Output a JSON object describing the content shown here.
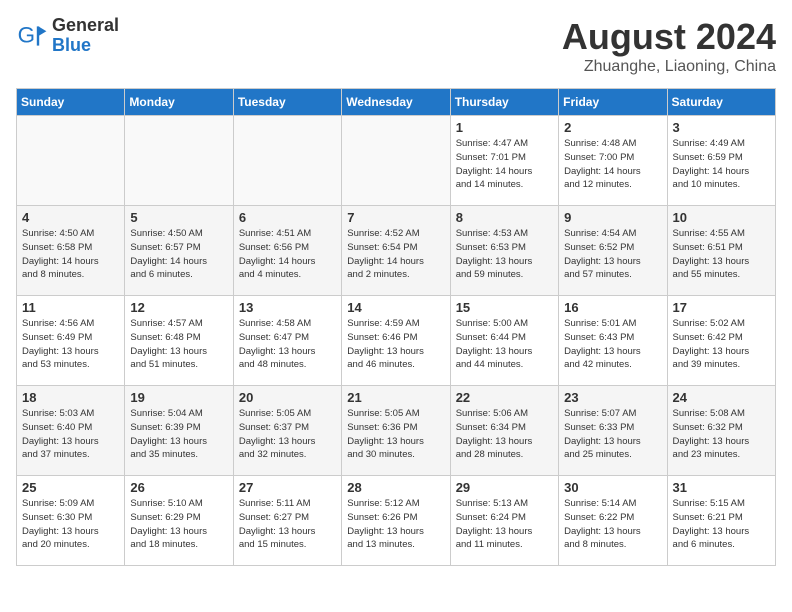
{
  "header": {
    "logo_general": "General",
    "logo_blue": "Blue",
    "month_title": "August 2024",
    "subtitle": "Zhuanghe, Liaoning, China"
  },
  "days_of_week": [
    "Sunday",
    "Monday",
    "Tuesday",
    "Wednesday",
    "Thursday",
    "Friday",
    "Saturday"
  ],
  "weeks": [
    [
      {
        "day": "",
        "detail": ""
      },
      {
        "day": "",
        "detail": ""
      },
      {
        "day": "",
        "detail": ""
      },
      {
        "day": "",
        "detail": ""
      },
      {
        "day": "1",
        "detail": "Sunrise: 4:47 AM\nSunset: 7:01 PM\nDaylight: 14 hours\nand 14 minutes."
      },
      {
        "day": "2",
        "detail": "Sunrise: 4:48 AM\nSunset: 7:00 PM\nDaylight: 14 hours\nand 12 minutes."
      },
      {
        "day": "3",
        "detail": "Sunrise: 4:49 AM\nSunset: 6:59 PM\nDaylight: 14 hours\nand 10 minutes."
      }
    ],
    [
      {
        "day": "4",
        "detail": "Sunrise: 4:50 AM\nSunset: 6:58 PM\nDaylight: 14 hours\nand 8 minutes."
      },
      {
        "day": "5",
        "detail": "Sunrise: 4:50 AM\nSunset: 6:57 PM\nDaylight: 14 hours\nand 6 minutes."
      },
      {
        "day": "6",
        "detail": "Sunrise: 4:51 AM\nSunset: 6:56 PM\nDaylight: 14 hours\nand 4 minutes."
      },
      {
        "day": "7",
        "detail": "Sunrise: 4:52 AM\nSunset: 6:54 PM\nDaylight: 14 hours\nand 2 minutes."
      },
      {
        "day": "8",
        "detail": "Sunrise: 4:53 AM\nSunset: 6:53 PM\nDaylight: 13 hours\nand 59 minutes."
      },
      {
        "day": "9",
        "detail": "Sunrise: 4:54 AM\nSunset: 6:52 PM\nDaylight: 13 hours\nand 57 minutes."
      },
      {
        "day": "10",
        "detail": "Sunrise: 4:55 AM\nSunset: 6:51 PM\nDaylight: 13 hours\nand 55 minutes."
      }
    ],
    [
      {
        "day": "11",
        "detail": "Sunrise: 4:56 AM\nSunset: 6:49 PM\nDaylight: 13 hours\nand 53 minutes."
      },
      {
        "day": "12",
        "detail": "Sunrise: 4:57 AM\nSunset: 6:48 PM\nDaylight: 13 hours\nand 51 minutes."
      },
      {
        "day": "13",
        "detail": "Sunrise: 4:58 AM\nSunset: 6:47 PM\nDaylight: 13 hours\nand 48 minutes."
      },
      {
        "day": "14",
        "detail": "Sunrise: 4:59 AM\nSunset: 6:46 PM\nDaylight: 13 hours\nand 46 minutes."
      },
      {
        "day": "15",
        "detail": "Sunrise: 5:00 AM\nSunset: 6:44 PM\nDaylight: 13 hours\nand 44 minutes."
      },
      {
        "day": "16",
        "detail": "Sunrise: 5:01 AM\nSunset: 6:43 PM\nDaylight: 13 hours\nand 42 minutes."
      },
      {
        "day": "17",
        "detail": "Sunrise: 5:02 AM\nSunset: 6:42 PM\nDaylight: 13 hours\nand 39 minutes."
      }
    ],
    [
      {
        "day": "18",
        "detail": "Sunrise: 5:03 AM\nSunset: 6:40 PM\nDaylight: 13 hours\nand 37 minutes."
      },
      {
        "day": "19",
        "detail": "Sunrise: 5:04 AM\nSunset: 6:39 PM\nDaylight: 13 hours\nand 35 minutes."
      },
      {
        "day": "20",
        "detail": "Sunrise: 5:05 AM\nSunset: 6:37 PM\nDaylight: 13 hours\nand 32 minutes."
      },
      {
        "day": "21",
        "detail": "Sunrise: 5:05 AM\nSunset: 6:36 PM\nDaylight: 13 hours\nand 30 minutes."
      },
      {
        "day": "22",
        "detail": "Sunrise: 5:06 AM\nSunset: 6:34 PM\nDaylight: 13 hours\nand 28 minutes."
      },
      {
        "day": "23",
        "detail": "Sunrise: 5:07 AM\nSunset: 6:33 PM\nDaylight: 13 hours\nand 25 minutes."
      },
      {
        "day": "24",
        "detail": "Sunrise: 5:08 AM\nSunset: 6:32 PM\nDaylight: 13 hours\nand 23 minutes."
      }
    ],
    [
      {
        "day": "25",
        "detail": "Sunrise: 5:09 AM\nSunset: 6:30 PM\nDaylight: 13 hours\nand 20 minutes."
      },
      {
        "day": "26",
        "detail": "Sunrise: 5:10 AM\nSunset: 6:29 PM\nDaylight: 13 hours\nand 18 minutes."
      },
      {
        "day": "27",
        "detail": "Sunrise: 5:11 AM\nSunset: 6:27 PM\nDaylight: 13 hours\nand 15 minutes."
      },
      {
        "day": "28",
        "detail": "Sunrise: 5:12 AM\nSunset: 6:26 PM\nDaylight: 13 hours\nand 13 minutes."
      },
      {
        "day": "29",
        "detail": "Sunrise: 5:13 AM\nSunset: 6:24 PM\nDaylight: 13 hours\nand 11 minutes."
      },
      {
        "day": "30",
        "detail": "Sunrise: 5:14 AM\nSunset: 6:22 PM\nDaylight: 13 hours\nand 8 minutes."
      },
      {
        "day": "31",
        "detail": "Sunrise: 5:15 AM\nSunset: 6:21 PM\nDaylight: 13 hours\nand 6 minutes."
      }
    ]
  ]
}
